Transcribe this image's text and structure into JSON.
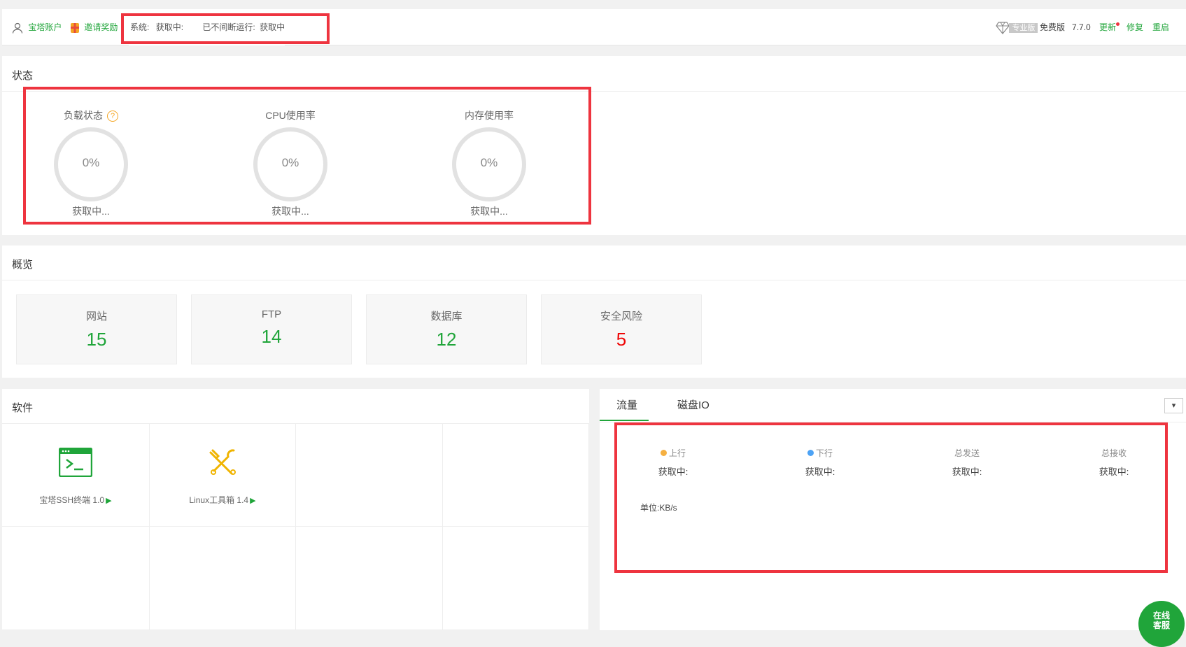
{
  "topbar": {
    "account_label": "宝塔账户",
    "invite_label": "邀请奖励",
    "system_label": "系统:",
    "system_value": "获取中:",
    "uptime_label": "已不间断运行:",
    "uptime_value": "获取中",
    "pro_badge": "专业版",
    "edition": "免费版",
    "version": "7.7.0",
    "update_label": "更新",
    "repair_label": "修复",
    "restart_label": "重启"
  },
  "status": {
    "title": "状态",
    "gauges": [
      {
        "title": "负载状态",
        "value": "0%",
        "sub": "获取中..."
      },
      {
        "title": "CPU使用率",
        "value": "0%",
        "sub": "获取中..."
      },
      {
        "title": "内存使用率",
        "value": "0%",
        "sub": "获取中..."
      }
    ]
  },
  "overview": {
    "title": "概览",
    "cards": [
      {
        "label": "网站",
        "value": "15"
      },
      {
        "label": "FTP",
        "value": "14"
      },
      {
        "label": "数据库",
        "value": "12"
      },
      {
        "label": "安全风险",
        "value": "5"
      }
    ]
  },
  "software": {
    "title": "软件",
    "items": [
      {
        "name": "宝塔SSH终端 1.0",
        "icon": "terminal-icon"
      },
      {
        "name": "Linux工具箱 1.4",
        "icon": "tools-icon"
      }
    ]
  },
  "traffic": {
    "tabs": [
      "流量",
      "磁盘IO"
    ],
    "columns": [
      {
        "label": "上行",
        "value": "获取中:"
      },
      {
        "label": "下行",
        "value": "获取中:"
      },
      {
        "label": "总发送",
        "value": "获取中:"
      },
      {
        "label": "总接收",
        "value": "获取中:"
      }
    ],
    "unit": "单位:KB/s",
    "select_arrow": "▾"
  },
  "chat": {
    "line1": "在线",
    "line2": "客服"
  },
  "colors": {
    "accent": "#20a53a",
    "danger": "#ef0808",
    "highlight": "#ee343f",
    "upload_dot": "#f5b041",
    "download_dot": "#4da3f5"
  }
}
